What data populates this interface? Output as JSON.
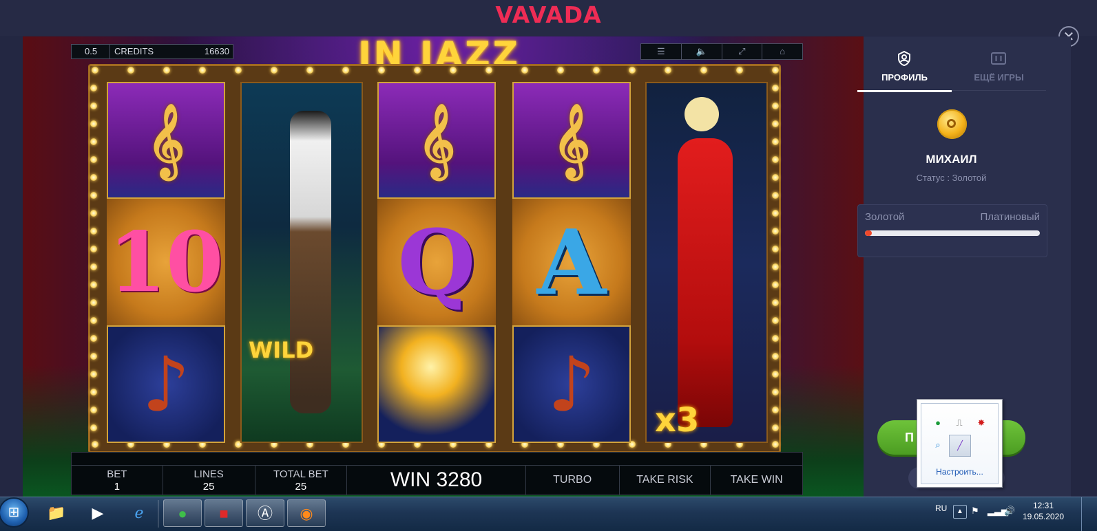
{
  "brand": {
    "logo": "VAVADA"
  },
  "game": {
    "title": "IN JAZZ",
    "credits": {
      "bet_per_line": "0.5",
      "label": "CREDITS",
      "value": "16630"
    },
    "top_tools": [
      "menu-icon",
      "sound-icon",
      "fullscreen-icon",
      "home-icon"
    ],
    "reels": [
      [
        "french-horn",
        "10",
        "double-bass"
      ],
      [
        "saxophonist-wild"
      ],
      [
        "french-horn",
        "Q",
        "trumpeter"
      ],
      [
        "french-horn",
        "A",
        "double-bass"
      ],
      [
        "singer-x3"
      ]
    ],
    "wild_label": "WILD",
    "multiplier_label": "x3",
    "bottom": {
      "bet_label": "BET",
      "bet_value": "1",
      "lines_label": "LINES",
      "lines_value": "25",
      "total_bet_label": "TOTAL BET",
      "total_bet_value": "25",
      "win": "WIN 3280",
      "turbo": "TURBO",
      "take_risk": "TAKE RISK",
      "take_win": "TAKE WIN"
    }
  },
  "sidebar": {
    "tabs": [
      {
        "label": "ПРОФИЛЬ",
        "icon": "profile-icon",
        "active": true
      },
      {
        "label": "ЕЩЁ ИГРЫ",
        "icon": "slot-machine-icon",
        "active": false
      }
    ],
    "user": {
      "name": "МИХАИЛ",
      "status": "Статус : Золотой"
    },
    "progress": {
      "from": "Золотой",
      "to": "Платиновый",
      "fraction": 0.04
    },
    "green_button_label": "П"
  },
  "tray_popup": {
    "icons": [
      "network-green-icon",
      "usb-icon",
      "antivirus-icon",
      "search-cursor-icon",
      "pen-icon"
    ],
    "link": "Настроить..."
  },
  "taskbar": {
    "apps": [
      "file-explorer-icon",
      "media-player-icon",
      "internet-explorer-icon",
      "green-app-icon",
      "red-app-icon",
      "anarchy-app-icon",
      "firefox-icon"
    ],
    "lang": "RU",
    "time": "12:31",
    "date": "19.05.2020"
  },
  "colors": {
    "brand_red": "#ef2c55",
    "sidebar_bg": "#2a2f4c",
    "green_button": "#5cb22e",
    "progress_fill": "#f0482a"
  }
}
